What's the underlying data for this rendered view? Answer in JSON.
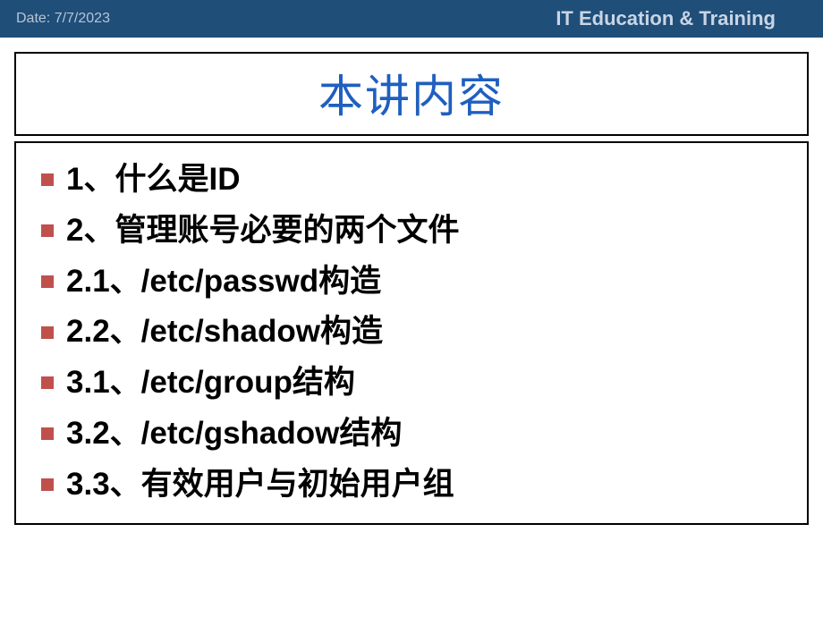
{
  "header": {
    "date_prefix": "Date: ",
    "date_value": "7/7/2023",
    "brand": "IT Education & Training"
  },
  "title": "本讲内容",
  "items": [
    "1、什么是ID",
    "2、管理账号必要的两个文件",
    "2.1、/etc/passwd构造",
    "2.2、/etc/shadow构造",
    "3.1、/etc/group结构",
    "3.2、/etc/gshadow结构",
    "3.3、有效用户与初始用户组"
  ],
  "colors": {
    "header_bg": "#1f4e79",
    "title_color": "#1f5fbf",
    "bullet_color": "#c0504d"
  }
}
